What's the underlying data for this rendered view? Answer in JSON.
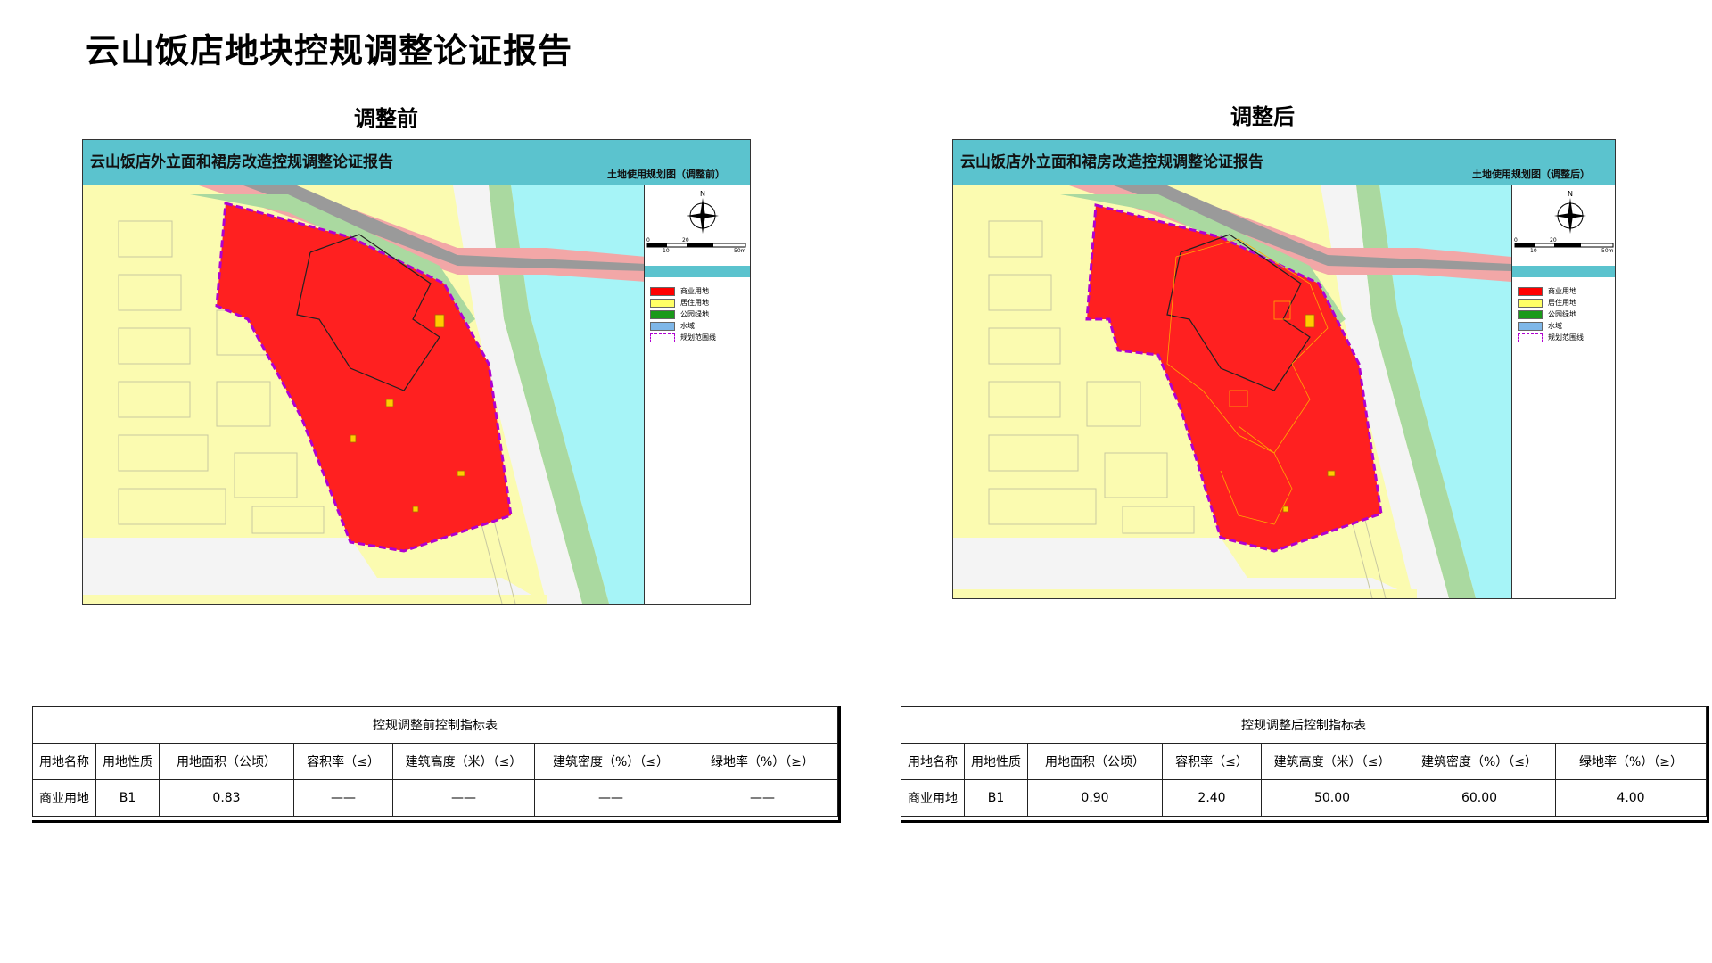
{
  "page": {
    "title": "云山饭店地块控规调整论证报告"
  },
  "before": {
    "heading": "调整前",
    "map_title": "云山饭店外立面和裙房改造控规调整论证报告",
    "map_subtitle": "土地使用规划图（调整前）",
    "table_caption": "控规调整前控制指标表",
    "row": [
      "商业用地",
      "B1",
      "0.83",
      "——",
      "——",
      "——",
      "——"
    ]
  },
  "after": {
    "heading": "调整后",
    "map_title": "云山饭店外立面和裙房改造控规调整论证报告",
    "map_subtitle": "土地使用规划图（调整后）",
    "table_caption": "控规调整后控制指标表",
    "row": [
      "商业用地",
      "B1",
      "0.90",
      "2.40",
      "50.00",
      "60.00",
      "4.00"
    ]
  },
  "table_headers": [
    "用地名称",
    "用地性质",
    "用地面积（公顷）",
    "容积率（≤）",
    "建筑高度（米）（≤）",
    "建筑密度（%）（≤）",
    "绿地率（%）（≥）"
  ],
  "legend": [
    {
      "label": "商业用地",
      "color": "#ff0000"
    },
    {
      "label": "居住用地",
      "color": "#ffff66"
    },
    {
      "label": "公园绿地",
      "color": "#1a9a1a"
    },
    {
      "label": "水域",
      "color": "#7fb7e8"
    },
    {
      "label": "规划范围线",
      "color": "#ffffff"
    }
  ],
  "scale": {
    "top": [
      "0",
      "20"
    ],
    "bottom": [
      "10",
      "50m"
    ]
  },
  "compass_label": "N",
  "colors": {
    "commercial": "#ff2020",
    "residential": "#fbfbb0",
    "water": "#a6f4f7",
    "green": "#aad9a0",
    "road": "#f2a7a7",
    "header": "#5bc3ce",
    "boundary": "#b000d0"
  }
}
